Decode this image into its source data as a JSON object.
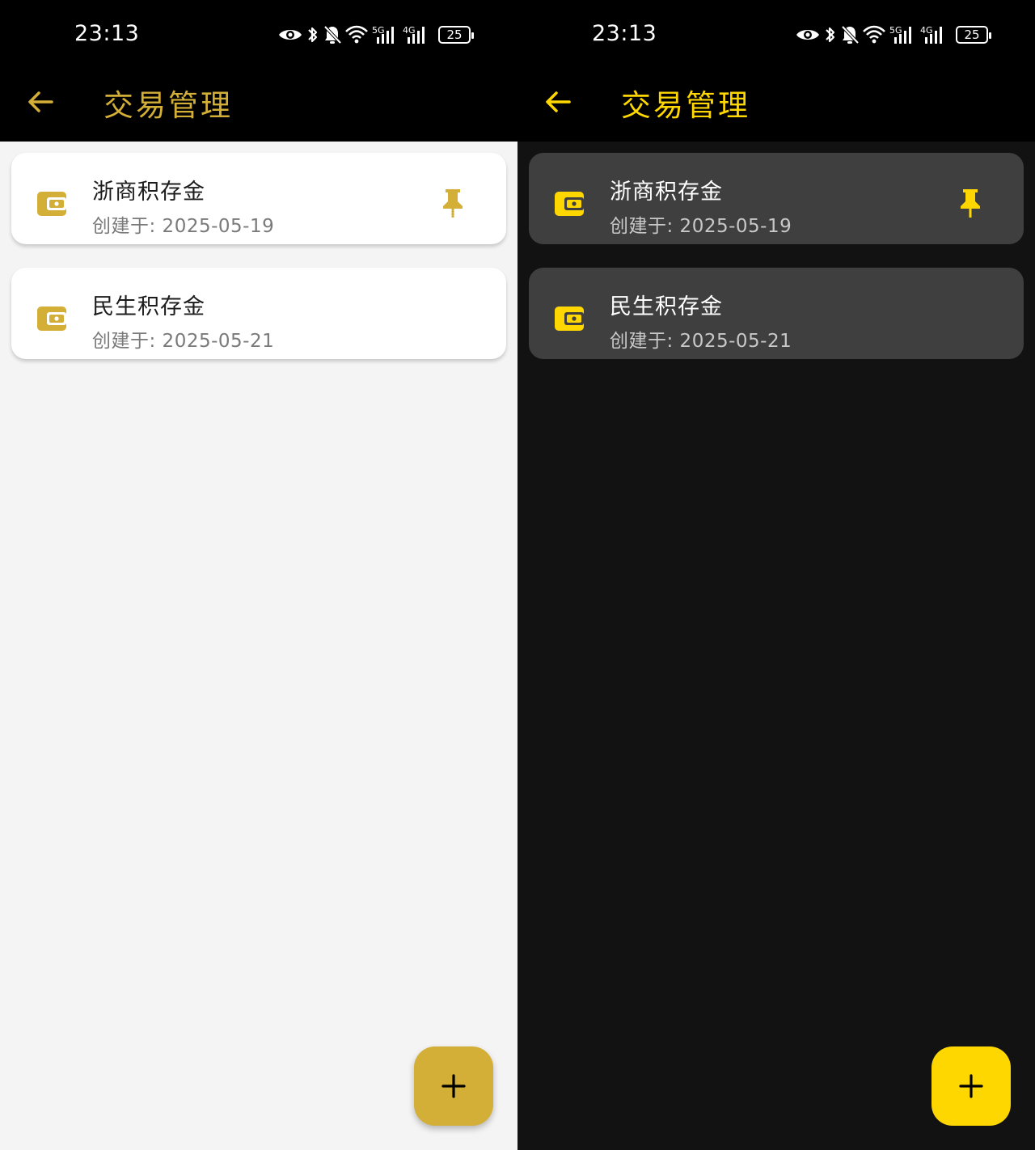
{
  "colors": {
    "light_accent": "#d4af37",
    "dark_accent": "#ffd700",
    "light_background": "#f4f4f4",
    "dark_background": "#121212",
    "light_card": "#ffffff",
    "dark_card": "#3f3f3f",
    "bars": "#000000"
  },
  "screens": [
    {
      "theme": "light",
      "status_bar": {
        "time": "23:13",
        "battery_level": "25",
        "icons": [
          "eye-icon",
          "bluetooth-icon",
          "bell-off-icon",
          "wifi-icon",
          "signal-5g-icon",
          "signal-4g-icon",
          "battery-icon"
        ]
      },
      "app_bar": {
        "back_icon": "arrow-left-icon",
        "title": "交易管理"
      },
      "accounts": [
        {
          "name": "浙商积存金",
          "created": "创建于: 2025-05-19",
          "icon": "wallet-icon",
          "pinned": true,
          "pin_icon": "pin-icon"
        },
        {
          "name": "民生积存金",
          "created": "创建于: 2025-05-21",
          "icon": "wallet-icon",
          "pinned": false
        }
      ],
      "fab": {
        "icon": "plus-icon"
      }
    },
    {
      "theme": "dark",
      "status_bar": {
        "time": "23:13",
        "battery_level": "25",
        "icons": [
          "eye-icon",
          "bluetooth-icon",
          "bell-off-icon",
          "wifi-icon",
          "signal-5g-icon",
          "signal-4g-icon",
          "battery-icon"
        ]
      },
      "app_bar": {
        "back_icon": "arrow-left-icon",
        "title": "交易管理"
      },
      "accounts": [
        {
          "name": "浙商积存金",
          "created": "创建于: 2025-05-19",
          "icon": "wallet-icon",
          "pinned": true,
          "pin_icon": "pin-icon"
        },
        {
          "name": "民生积存金",
          "created": "创建于: 2025-05-21",
          "icon": "wallet-icon",
          "pinned": false
        }
      ],
      "fab": {
        "icon": "plus-icon"
      }
    }
  ]
}
